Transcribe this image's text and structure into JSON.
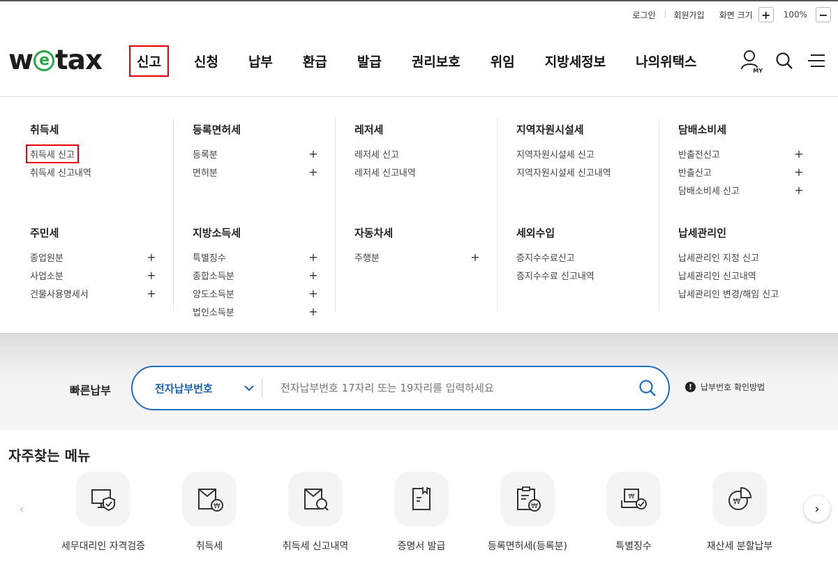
{
  "util": {
    "login": "로그인",
    "signup": "회원가입",
    "screen_size": "화면 크기",
    "zoom_in": "+",
    "zoom_value": "100%",
    "zoom_out": "−"
  },
  "logo": {
    "pre": "w",
    "mid": "e",
    "post": "tax"
  },
  "gnb": {
    "items": [
      "신고",
      "신청",
      "납부",
      "환급",
      "발급",
      "권리보호",
      "위임",
      "지방세정보",
      "나의위택스"
    ],
    "active": "신고",
    "my_label": "MY"
  },
  "mega": {
    "row1": [
      {
        "title": "취득세",
        "items": [
          {
            "label": "취득세 신고",
            "plus": ""
          },
          {
            "label": "취득세 신고내역",
            "plus": ""
          }
        ]
      },
      {
        "title": "등록면허세",
        "items": [
          {
            "label": "등록분",
            "plus": "+"
          },
          {
            "label": "면허분",
            "plus": "+"
          }
        ]
      },
      {
        "title": "레저세",
        "items": [
          {
            "label": "레저세 신고",
            "plus": ""
          },
          {
            "label": "레저세 신고내역",
            "plus": ""
          }
        ]
      },
      {
        "title": "지역자원시설세",
        "items": [
          {
            "label": "지역자원시설세 신고",
            "plus": ""
          },
          {
            "label": "지역자원시설세 신고내역",
            "plus": ""
          }
        ]
      },
      {
        "title": "담배소비세",
        "items": [
          {
            "label": "반출전신고",
            "plus": "+"
          },
          {
            "label": "반출신고",
            "plus": "+"
          },
          {
            "label": "담배소비세 신고",
            "plus": "+"
          }
        ]
      }
    ],
    "row2": [
      {
        "title": "주민세",
        "items": [
          {
            "label": "종업원분",
            "plus": "+"
          },
          {
            "label": "사업소분",
            "plus": "+"
          },
          {
            "label": "건물사용명세서",
            "plus": "+"
          }
        ]
      },
      {
        "title": "지방소득세",
        "items": [
          {
            "label": "특별징수",
            "plus": "+"
          },
          {
            "label": "종합소득분",
            "plus": "+"
          },
          {
            "label": "양도소득분",
            "plus": "+"
          },
          {
            "label": "법인소득분",
            "plus": "+"
          }
        ]
      },
      {
        "title": "자동차세",
        "items": [
          {
            "label": "주행분",
            "plus": "+"
          }
        ]
      },
      {
        "title": "세외수입",
        "items": [
          {
            "label": "증지수수료신고",
            "plus": ""
          },
          {
            "label": "증지수수료 신고내역",
            "plus": ""
          }
        ]
      },
      {
        "title": "납세관리인",
        "items": [
          {
            "label": "납세관리인 지정 신고",
            "plus": ""
          },
          {
            "label": "납세관리인 신고내역",
            "plus": ""
          },
          {
            "label": "납세관리인 변경/해임 신고",
            "plus": ""
          }
        ]
      }
    ],
    "highlighted": "취득세 신고"
  },
  "quickpay": {
    "title": "빠른납부",
    "select_value": "전자납부번호",
    "placeholder": "전자납부번호 17자리 또는 19자리를 입력하세요",
    "help": "납부번호 확인방법",
    "help_icon": "!"
  },
  "frequent": {
    "title": "자주찾는 메뉴",
    "prev": "‹",
    "next": "›",
    "items": [
      {
        "label": "세무대리인 자격검증",
        "icon": "monitor-shield-icon"
      },
      {
        "label": "취득세",
        "icon": "envelope-won-icon"
      },
      {
        "label": "취득세 신고내역",
        "icon": "envelope-search-icon"
      },
      {
        "label": "증명서 발급",
        "icon": "document-bookmark-icon"
      },
      {
        "label": "등록면허세(등록분)",
        "icon": "clipboard-won-icon"
      },
      {
        "label": "특별징수",
        "icon": "tray-check-icon"
      },
      {
        "label": "재산세 분할납부",
        "icon": "pie-won-icon"
      }
    ]
  }
}
